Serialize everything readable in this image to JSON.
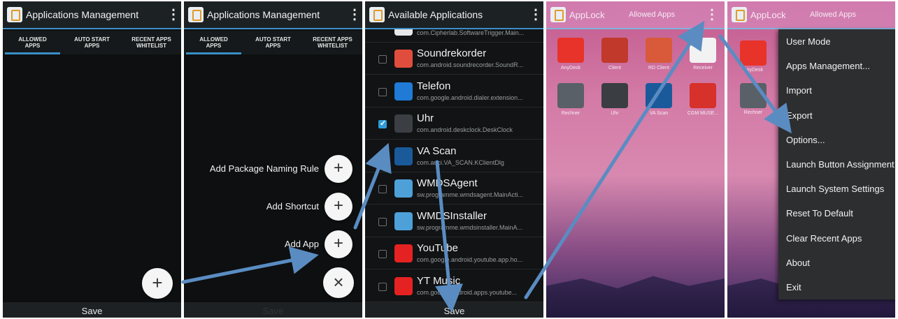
{
  "panel1": {
    "title": "Applications Management",
    "tabs": [
      "ALLOWED\nAPPS",
      "AUTO START\nAPPS",
      "RECENT APPS\nWHITELIST"
    ],
    "fab": "+",
    "save": "Save"
  },
  "panel2": {
    "title": "Applications Management",
    "tabs": [
      "ALLOWED\nAPPS",
      "AUTO START\nAPPS",
      "RECENT APPS\nWHITELIST"
    ],
    "actions": [
      "Add Package Naming Rule",
      "Add Shortcut",
      "Add App"
    ],
    "plus": "+",
    "close": "×",
    "save": "Save"
  },
  "panel3": {
    "title": "Available Applications",
    "top_pkg": "com.Cipherlab.SoftwareTrigger.Main...",
    "apps": [
      {
        "name": "Soundrekorder",
        "pkg": "com.android.soundrecorder.SoundR...",
        "checked": false,
        "color": "#e14d3c"
      },
      {
        "name": "Telefon",
        "pkg": "com.google.android.dialer.extension...",
        "checked": false,
        "color": "#1f7bd6"
      },
      {
        "name": "Uhr",
        "pkg": "com.android.deskclock.DeskClock",
        "checked": true,
        "color": "#3b3f43"
      },
      {
        "name": "VA Scan",
        "pkg": "com.auci.VA_SCAN.KClientDlg",
        "checked": false,
        "color": "#1a5a9a"
      },
      {
        "name": "WMDSAgent",
        "pkg": "sw.programme.wmdsagent.MainActi...",
        "checked": false,
        "color": "#4da0d8"
      },
      {
        "name": "WMDSInstaller",
        "pkg": "sw.programme.wmdsinstaller.MainA...",
        "checked": false,
        "color": "#4da0d8"
      },
      {
        "name": "YouTube",
        "pkg": "com.google.android.youtube.app.ho...",
        "checked": false,
        "color": "#e52222"
      },
      {
        "name": "YT Music",
        "pkg": "com.google.android.apps.youtube...",
        "checked": false,
        "color": "#e52222"
      }
    ],
    "save": "Save"
  },
  "panel4": {
    "title": "AppLock",
    "subtitle": "Allowed Apps",
    "apps": [
      {
        "label": "AnyDesk",
        "color": "#e8332a"
      },
      {
        "label": "Client",
        "color": "#c0392b"
      },
      {
        "label": "RD Client",
        "color": "#d85a3a"
      },
      {
        "label": "Receiver",
        "color": "#f2f2f2"
      },
      {
        "label": "Rechner",
        "color": "#5a6068"
      },
      {
        "label": "Uhr",
        "color": "#3a3d42"
      },
      {
        "label": "VA Scan",
        "color": "#1a5a9a"
      },
      {
        "label": "CGM MUSE...",
        "color": "#d6312b"
      }
    ]
  },
  "panel5": {
    "title": "AppLock",
    "subtitle": "Allowed Apps",
    "partial_labels": [
      "AnyDesk",
      "Rechner"
    ],
    "menu": [
      "User Mode",
      "Apps Management...",
      "Import",
      "Export",
      "Options...",
      "Launch Button Assignment",
      "Launch System Settings",
      "Reset To Default",
      "Clear Recent Apps",
      "About",
      "Exit"
    ]
  },
  "colors": {
    "accent": "#3a8fc6",
    "arrow": "#5a8cc2"
  }
}
